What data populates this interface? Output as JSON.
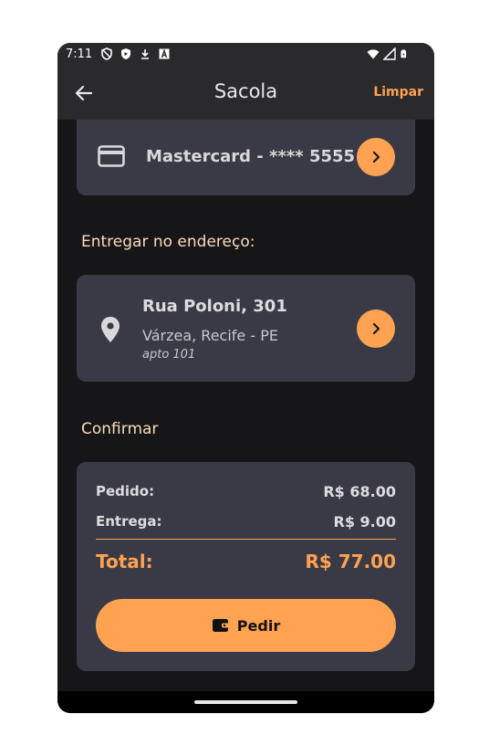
{
  "status_bar": {
    "time": "7:11",
    "icons_left": [
      "shield-outline-icon",
      "shield-filled-icon",
      "download-icon",
      "a-box-icon"
    ],
    "icons_right": [
      "wifi-icon",
      "signal-icon",
      "battery-icon"
    ]
  },
  "app_bar": {
    "title": "Sacola",
    "back_icon": "arrow-left-icon",
    "clear_label": "Limpar"
  },
  "payment": {
    "icon": "credit-card-icon",
    "label": "Mastercard - **** 5555",
    "action_icon": "chevron-right-icon"
  },
  "delivery": {
    "section_label": "Entregar no endereço:",
    "icon": "location-pin-icon",
    "street": "Rua Poloni, 301",
    "city": "Várzea, Recife - PE",
    "complement": "apto 101",
    "action_icon": "chevron-right-icon"
  },
  "confirm": {
    "section_label": "Confirmar",
    "order_label": "Pedido:",
    "order_value": "R$ 68.00",
    "delivery_label": "Entrega:",
    "delivery_value": "R$ 9.00",
    "total_label": "Total:",
    "total_value": "R$ 77.00",
    "button_label": "Pedir",
    "button_icon": "wallet-icon"
  },
  "colors": {
    "accent": "#ffa252",
    "background": "#161618",
    "card": "#393a45",
    "app_bar": "#2a2a2d",
    "section_label": "#fcdcb8"
  }
}
